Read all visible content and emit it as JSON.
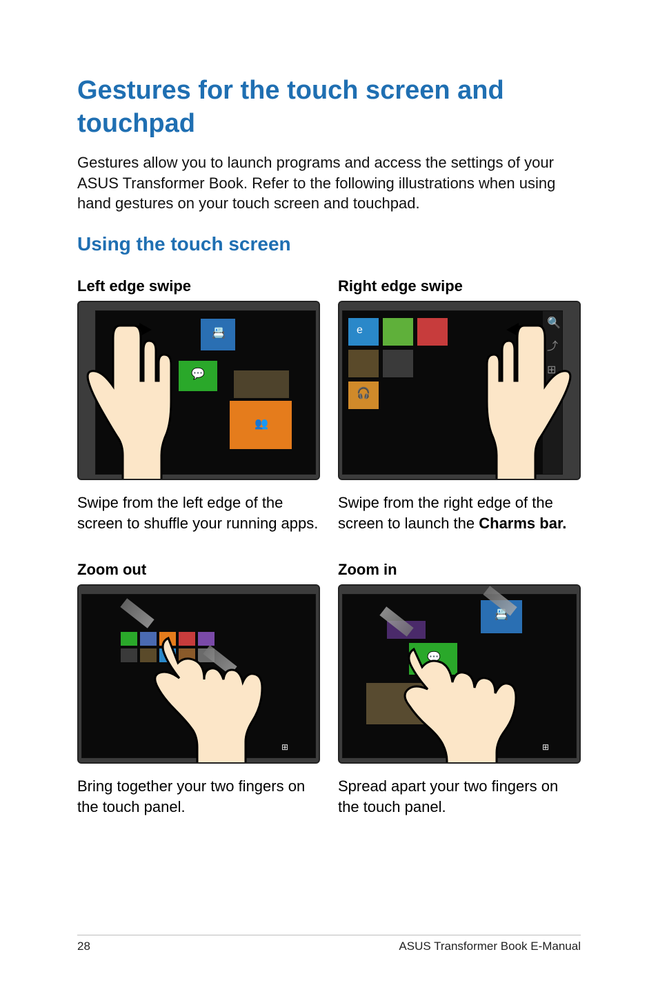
{
  "title": "Gestures for the touch screen and touchpad",
  "intro": "Gestures allow you to launch programs and access the settings of your ASUS Transformer Book. Refer to the following illustrations when using hand gestures on your touch screen and touchpad.",
  "subtitle": "Using the touch screen",
  "gestures": {
    "left_swipe": {
      "title": "Left edge swipe",
      "desc": "Swipe from the left edge of the screen to shuffle your running apps."
    },
    "right_swipe": {
      "title": "Right edge swipe",
      "desc_prefix": "Swipe from the right edge of the screen to launch the ",
      "desc_bold": "Charms bar."
    },
    "zoom_out": {
      "title": "Zoom out",
      "desc": "Bring together your two fingers on the touch panel."
    },
    "zoom_in": {
      "title": "Zoom in",
      "desc": "Spread apart your two fingers on the touch panel."
    }
  },
  "footer": {
    "page_number": "28",
    "doc_title": "ASUS Transformer Book E-Manual"
  },
  "colors": {
    "heading_blue": "#1f6fb2"
  }
}
